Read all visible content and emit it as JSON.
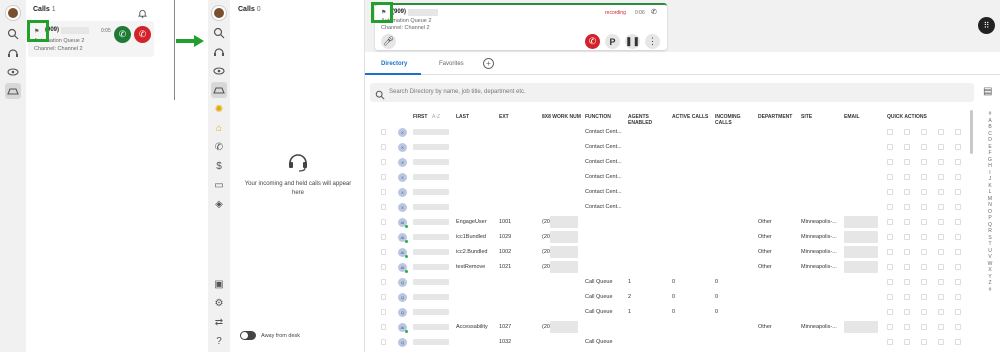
{
  "left_panel": {
    "calls_title": "Calls",
    "calls_count": "1",
    "call_card": {
      "number": "(909)",
      "timer": "0:05",
      "queue": "Automation Queue 2",
      "channel": "Channel: Channel 2"
    }
  },
  "middle_panel": {
    "calls_title": "Calls",
    "calls_count": "0",
    "empty_message": "Your incoming and held calls will appear here",
    "away_label": "Away from desk"
  },
  "active_call": {
    "number": "(909)",
    "status": "recording",
    "timer": "0:06",
    "queue": "Automation Queue 2",
    "channel": "Channel: Channel 2",
    "park_label": "P"
  },
  "directory": {
    "tabs": [
      "Directory",
      "Favorites"
    ],
    "search_placeholder": "Search Directory by name, job title, department etc.",
    "columns": [
      "FIRST",
      "A-Z",
      "LAST",
      "EXT",
      "8X8 WORK NUM",
      "FUNCTION",
      "AGENTS ENABLED",
      "ACTIVE CALLS",
      "INCOMING CALLS",
      "DEPARTMENT",
      "SITE",
      "EMAIL",
      "QUICK ACTIONS"
    ],
    "rows": [
      {
        "avatar": "X",
        "last": "",
        "ext": "",
        "work": "",
        "function": "Contact Cent...",
        "agents": "",
        "active": "",
        "incoming": "",
        "dept": "",
        "site": ""
      },
      {
        "avatar": "X",
        "last": "",
        "ext": "",
        "work": "",
        "function": "Contact Cent...",
        "agents": "",
        "active": "",
        "incoming": "",
        "dept": "",
        "site": ""
      },
      {
        "avatar": "X",
        "last": "",
        "ext": "",
        "work": "",
        "function": "Contact Cent...",
        "agents": "",
        "active": "",
        "incoming": "",
        "dept": "",
        "site": ""
      },
      {
        "avatar": "X",
        "last": "",
        "ext": "",
        "work": "",
        "function": "Contact Cent...",
        "agents": "",
        "active": "",
        "incoming": "",
        "dept": "",
        "site": ""
      },
      {
        "avatar": "X",
        "last": "",
        "ext": "",
        "work": "",
        "function": "Contact Cent...",
        "agents": "",
        "active": "",
        "incoming": "",
        "dept": "",
        "site": ""
      },
      {
        "avatar": "X",
        "last": "",
        "ext": "",
        "work": "",
        "function": "Contact Cent...",
        "agents": "",
        "active": "",
        "incoming": "",
        "dept": "",
        "site": ""
      },
      {
        "avatar": "AI",
        "last": "EngageUser",
        "ext": "1001",
        "work": "(206",
        "function": "",
        "agents": "",
        "active": "",
        "incoming": "",
        "dept": "Other",
        "site": "Minneapolis-..."
      },
      {
        "avatar": "AI",
        "last": "icc1Bundled",
        "ext": "1029",
        "work": "(206",
        "function": "",
        "agents": "",
        "active": "",
        "incoming": "",
        "dept": "Other",
        "site": "Minneapolis-..."
      },
      {
        "avatar": "AI",
        "last": "icc2.Bundled",
        "ext": "1002",
        "work": "(206",
        "function": "",
        "agents": "",
        "active": "",
        "incoming": "",
        "dept": "Other",
        "site": "Minneapolis-..."
      },
      {
        "avatar": "AI",
        "last": "testRemove",
        "ext": "1021",
        "work": "(206",
        "function": "",
        "agents": "",
        "active": "",
        "incoming": "",
        "dept": "Other",
        "site": "Minneapolis-..."
      },
      {
        "avatar": "Q",
        "last": "",
        "ext": "",
        "work": "",
        "function": "Call Queue",
        "agents": "1",
        "active": "0",
        "incoming": "0",
        "dept": "",
        "site": ""
      },
      {
        "avatar": "Q",
        "last": "",
        "ext": "",
        "work": "",
        "function": "Call Queue",
        "agents": "2",
        "active": "0",
        "incoming": "0",
        "dept": "",
        "site": ""
      },
      {
        "avatar": "Q",
        "last": "",
        "ext": "",
        "work": "",
        "function": "Call Queue",
        "agents": "1",
        "active": "0",
        "incoming": "0",
        "dept": "",
        "site": ""
      },
      {
        "avatar": "AI",
        "last": "Accessability",
        "ext": "1027",
        "work": "(206",
        "function": "",
        "agents": "",
        "active": "",
        "incoming": "",
        "dept": "Other",
        "site": "Minneapolis-..."
      },
      {
        "avatar": "Q",
        "last": "",
        "ext": "1032",
        "work": "",
        "function": "Call Queue",
        "agents": "",
        "active": "",
        "incoming": "",
        "dept": "",
        "site": ""
      }
    ],
    "alphabet": [
      "#",
      "A",
      "B",
      "C",
      "D",
      "E",
      "F",
      "G",
      "H",
      "I",
      "J",
      "K",
      "L",
      "M",
      "N",
      "O",
      "P",
      "Q",
      "R",
      "S",
      "T",
      "U",
      "V",
      "W",
      "X",
      "Y",
      "Z",
      "#"
    ]
  },
  "colors": {
    "accent": "#1a73c9",
    "answer_green": "#1f7a36",
    "hangup_red": "#d2232a",
    "annotation_green": "#22a02e"
  }
}
